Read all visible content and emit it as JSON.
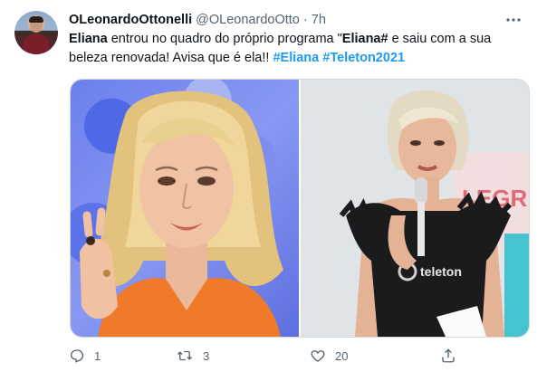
{
  "tweet": {
    "display_name": "OLeonardoOttonelli",
    "handle": "@OLeonardoOtto",
    "separator": "·",
    "time": "7h",
    "text": {
      "name_bold": "Eliana",
      "part1": " entrou no quadro do próprio programa \"",
      "program_bold": "Eliana#",
      "part2": " e saiu com a sua beleza renovada! Avisa que é ela!! ",
      "hashtag1": "#Eliana",
      "space": " ",
      "hashtag2": "#Teleton2021"
    },
    "media": {
      "right_photo": {
        "banner_text": "LEGRIA",
        "shirt_text": "teleton"
      }
    },
    "actions": {
      "reply_count": "1",
      "retweet_count": "3",
      "like_count": "20"
    }
  },
  "icons": {
    "more": "more-icon",
    "reply": "reply-icon",
    "retweet": "retweet-icon",
    "like": "like-icon",
    "share": "share-icon"
  },
  "colors": {
    "text": "#0f1419",
    "secondary": "#536471",
    "link": "#1d9bf0",
    "border": "#cfd9de"
  }
}
